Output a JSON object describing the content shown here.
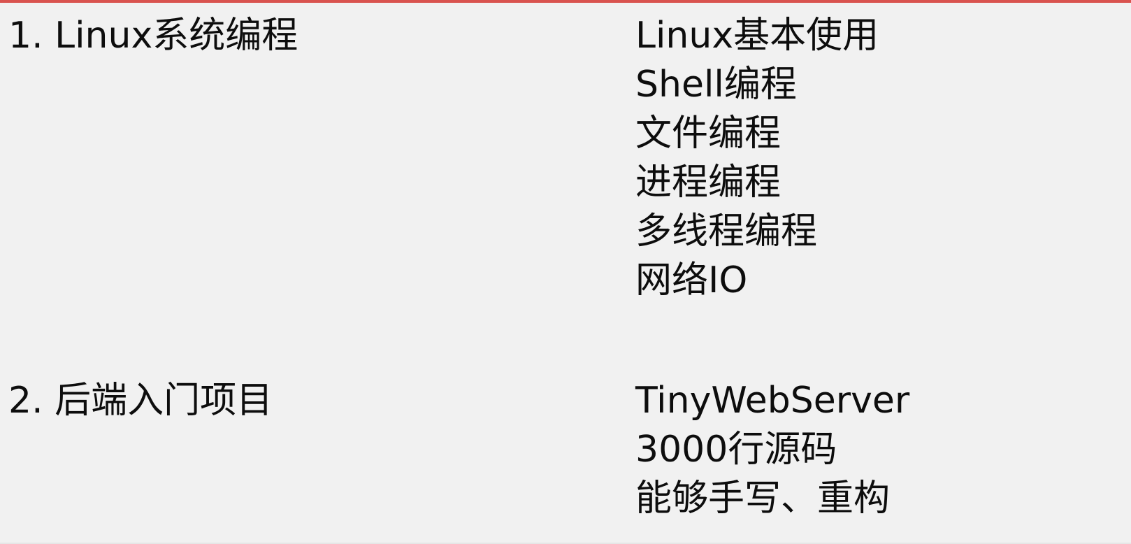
{
  "slide": {
    "accent_color": "#d9534f",
    "background_color": "#f1f1f1",
    "text_color": "#0d0d0d",
    "sections": [
      {
        "title": "1. Linux系统编程",
        "topics": [
          "Linux基本使用",
          "Shell编程",
          "文件编程",
          "进程编程",
          "多线程编程",
          "网络IO"
        ]
      },
      {
        "title": "2. 后端入门项目",
        "topics": [
          "TinyWebServer",
          "3000行源码",
          "能够手写、重构"
        ]
      }
    ]
  }
}
